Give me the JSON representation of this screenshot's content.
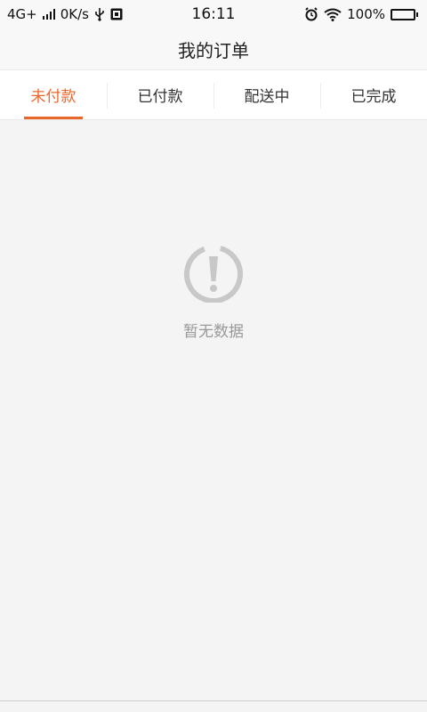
{
  "status_bar": {
    "network": "4G+",
    "speed": "0K/s",
    "time": "16:11",
    "battery": "100%"
  },
  "header": {
    "title": "我的订单"
  },
  "tabs": [
    {
      "label": "未付款",
      "active": true
    },
    {
      "label": "已付款",
      "active": false
    },
    {
      "label": "配送中",
      "active": false
    },
    {
      "label": "已完成",
      "active": false
    }
  ],
  "empty_state": {
    "icon": "alert-circle-icon",
    "message": "暂无数据"
  },
  "colors": {
    "accent": "#e9672a",
    "background": "#f4f4f4",
    "muted_text": "#999999"
  }
}
